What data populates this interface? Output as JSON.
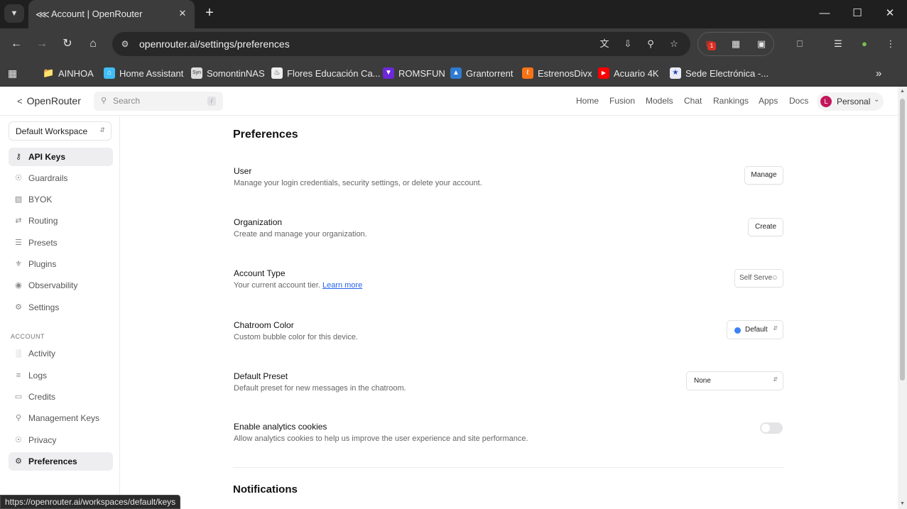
{
  "browser": {
    "tab_title": "Account | OpenRouter",
    "url": "openrouter.ai/settings/preferences",
    "notification_badge": "1",
    "bookmarks": [
      {
        "label": "AINHOA",
        "icon": "folder-icon"
      },
      {
        "label": "Home Assistant",
        "icon": "home-assistant-icon"
      },
      {
        "label": "SomontinNAS",
        "icon": "synology-icon"
      },
      {
        "label": "Flores Educación Ca...",
        "icon": "flores-icon"
      },
      {
        "label": "ROMSFUN",
        "icon": "romsfun-icon"
      },
      {
        "label": "Grantorrent",
        "icon": "grantorrent-icon"
      },
      {
        "label": "EstrenosDivx",
        "icon": "estrenosdivx-icon"
      },
      {
        "label": "Acuario 4K",
        "icon": "youtube-icon"
      },
      {
        "label": "Sede Electrónica -...",
        "icon": "sede-icon"
      }
    ],
    "status_url": "https://openrouter.ai/workspaces/default/keys"
  },
  "topnav": {
    "brand": "OpenRouter",
    "search_placeholder": "Search",
    "search_shortcut": "/",
    "links": [
      "Home",
      "Fusion",
      "Models",
      "Chat",
      "Rankings",
      "Apps",
      "Docs"
    ],
    "account_initial": "L",
    "account_label": "Personal"
  },
  "sidebar": {
    "workspace": "Default Workspace",
    "items": [
      {
        "label": "API Keys",
        "icon": "key-icon"
      },
      {
        "label": "Guardrails",
        "icon": "shield-icon"
      },
      {
        "label": "BYOK",
        "icon": "database-icon"
      },
      {
        "label": "Routing",
        "icon": "routing-icon"
      },
      {
        "label": "Presets",
        "icon": "sliders-icon"
      },
      {
        "label": "Plugins",
        "icon": "plugin-icon"
      },
      {
        "label": "Observability",
        "icon": "eye-icon"
      },
      {
        "label": "Settings",
        "icon": "gear-icon"
      }
    ],
    "section_label": "ACCOUNT",
    "account_items": [
      {
        "label": "Activity",
        "icon": "bar-chart-icon"
      },
      {
        "label": "Logs",
        "icon": "list-icon"
      },
      {
        "label": "Credits",
        "icon": "credit-card-icon"
      },
      {
        "label": "Management Keys",
        "icon": "lock-icon"
      },
      {
        "label": "Privacy",
        "icon": "shield-icon"
      },
      {
        "label": "Preferences",
        "icon": "gear-icon"
      }
    ]
  },
  "preferences": {
    "title": "Preferences",
    "user": {
      "title": "User",
      "desc": "Manage your login credentials, security settings, or delete your account.",
      "button": "Manage"
    },
    "organization": {
      "title": "Organization",
      "desc": "Create and manage your organization.",
      "button": "Create"
    },
    "account_type": {
      "title": "Account Type",
      "desc": "Your current account tier.",
      "link": "Learn more",
      "value": "Self Serve"
    },
    "chatroom_color": {
      "title": "Chatroom Color",
      "desc": "Custom bubble color for this device.",
      "value": "Default",
      "swatch_color": "#3b82f6"
    },
    "default_preset": {
      "title": "Default Preset",
      "desc": "Default preset for new messages in the chatroom.",
      "value": "None"
    },
    "analytics": {
      "title": "Enable analytics cookies",
      "desc": "Allow analytics cookies to help us improve the user experience and site performance.",
      "enabled": false
    },
    "notifications_title": "Notifications"
  }
}
